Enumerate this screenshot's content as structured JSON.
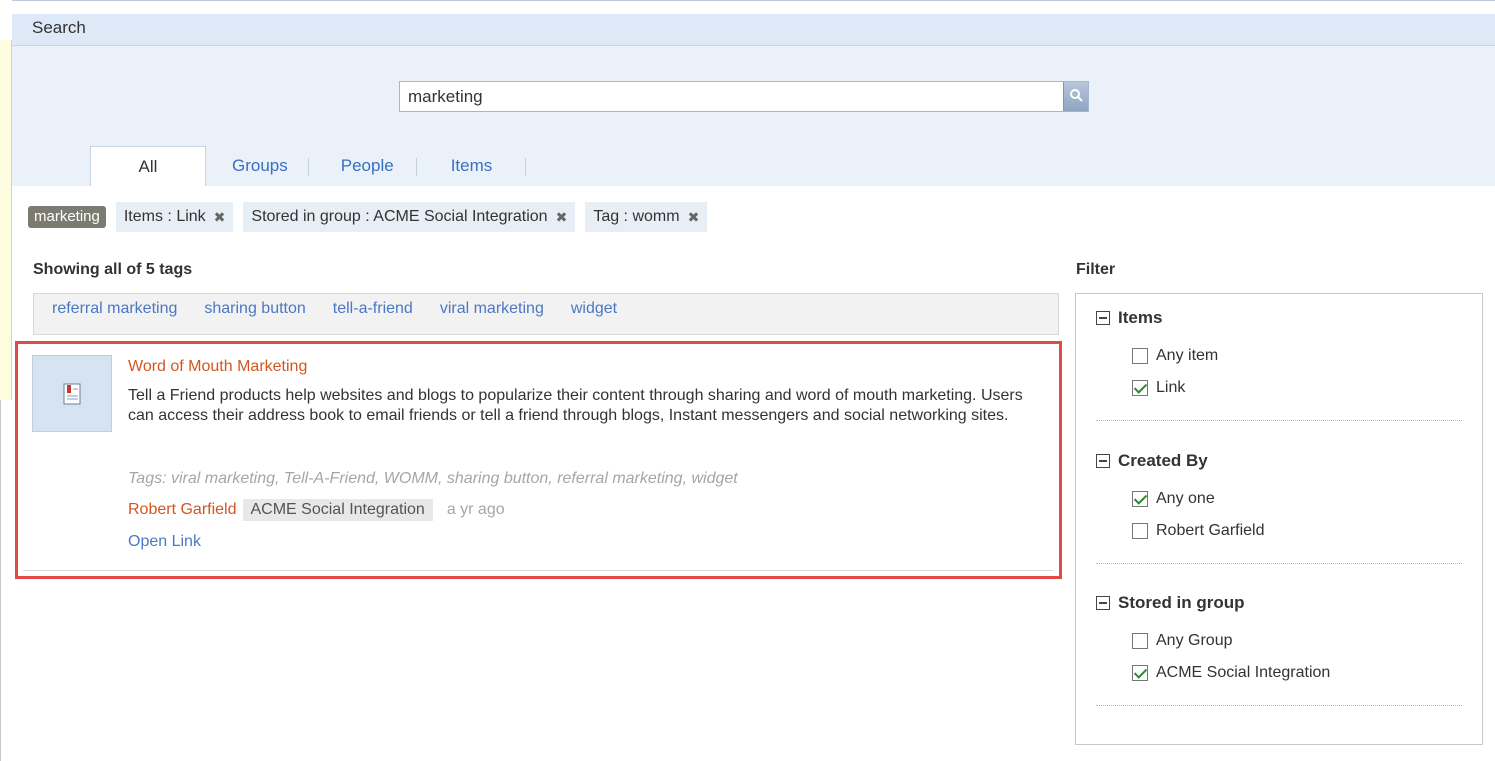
{
  "window": {
    "title": "Search"
  },
  "search": {
    "value": "marketing"
  },
  "tabs": [
    {
      "label": "All"
    },
    {
      "label": "Groups"
    },
    {
      "label": "People"
    },
    {
      "label": "Items"
    }
  ],
  "chips": {
    "query": "marketing",
    "filters": [
      {
        "label": "Items : Link",
        "remove": "✖"
      },
      {
        "label": "Stored in group : ACME Social Integration",
        "remove": "✖"
      },
      {
        "label": "Tag : womm",
        "remove": "✖"
      }
    ]
  },
  "results": {
    "showing_label": "Showing all of 5 tags",
    "tags": [
      "referral marketing",
      "sharing button",
      "tell-a-friend",
      "viral marketing",
      "widget"
    ],
    "item": {
      "title": "Word of Mouth Marketing",
      "description": "Tell a Friend products help websites and blogs to popularize their content through sharing and word of mouth marketing. Users can access their address book to email friends or tell a friend through blogs, Instant messengers and social networking sites.",
      "tags_line": "Tags: viral marketing, Tell-A-Friend, WOMM, sharing button, referral marketing, widget",
      "author": "Robert Garfield",
      "group": "ACME Social Integration",
      "time": "a yr ago",
      "open_link": "Open Link",
      "icon": "document-icon"
    }
  },
  "filter": {
    "title": "Filter",
    "sections": [
      {
        "title": "Items",
        "options": [
          {
            "label": "Any item",
            "checked": false
          },
          {
            "label": "Link",
            "checked": true
          }
        ]
      },
      {
        "title": "Created By",
        "options": [
          {
            "label": "Any one",
            "checked": true
          },
          {
            "label": "Robert Garfield",
            "checked": false
          }
        ]
      },
      {
        "title": "Stored in group",
        "options": [
          {
            "label": "Any Group",
            "checked": false
          },
          {
            "label": "ACME Social Integration",
            "checked": true
          }
        ]
      }
    ]
  },
  "colors": {
    "accent_link": "#4a78c4",
    "title_orange": "#d35620",
    "highlight_border": "#e04a49",
    "header_bg": "#dde9f7"
  }
}
